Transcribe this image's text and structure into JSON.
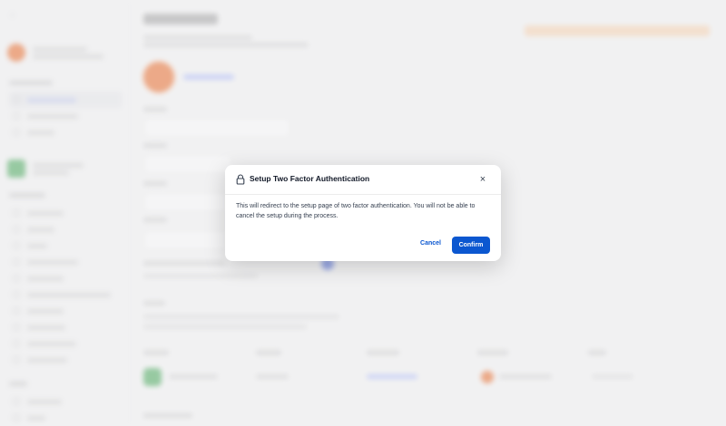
{
  "dialog": {
    "title": "Setup Two Factor Authentication",
    "body": "This will redirect to the setup page of two factor authentication. You will not be able to cancel the setup during the process.",
    "cancel_label": "Cancel",
    "confirm_label": "Confirm",
    "close_glyph": "×"
  },
  "background": {
    "back_glyph": "‹",
    "icons": {
      "lock": "lock-icon",
      "close": "close-icon"
    },
    "colors": {
      "accent": "#0b57d0",
      "avatar": "#ea580c",
      "workspace": "#2f9e44"
    }
  }
}
